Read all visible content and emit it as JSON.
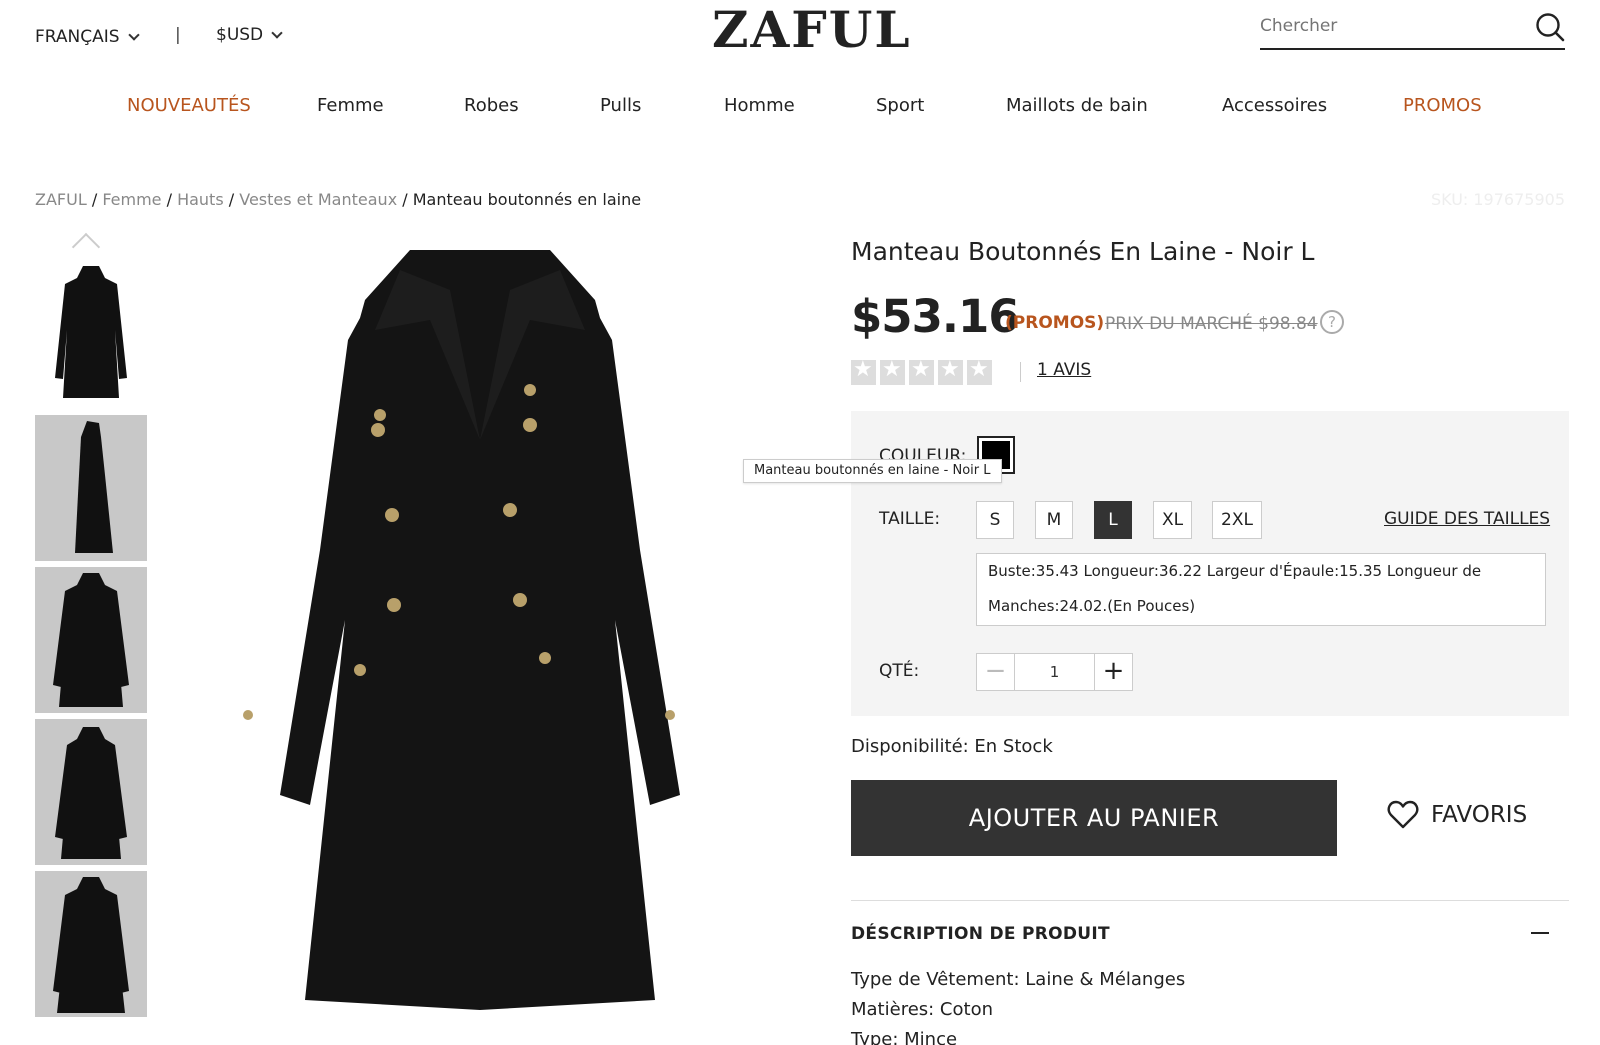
{
  "header": {
    "language": "FRANÇAIS",
    "separator": "|",
    "currency": "$USD",
    "logo": "ZAFUL",
    "search_placeholder": "Chercher"
  },
  "nav": {
    "items": [
      "NOUVEAUTÉS",
      "Femme",
      "Robes",
      "Pulls",
      "Homme",
      "Sport",
      "Maillots de bain",
      "Accessoires",
      "PROMOS"
    ]
  },
  "breadcrumb": {
    "items": [
      "ZAFUL",
      "Femme",
      "Hauts",
      "Vestes et Manteaux"
    ],
    "separator": "/",
    "current": "Manteau boutonnés en laine",
    "sku": "SKU: 197675905"
  },
  "product": {
    "title": "Manteau Boutonnés En Laine - Noir L",
    "price": "$53.16",
    "promo_label": "(PROMOS)",
    "market_price": "PRIX DU MARCHÉ $98.84",
    "help": "?",
    "rating_stars": 0,
    "reviews": "1 AVIS"
  },
  "options": {
    "color_label": "COULEUR:",
    "color_tooltip": "Manteau boutonnés en laine - Noir L",
    "size_label": "TAILLE:",
    "sizes": [
      "S",
      "M",
      "L",
      "XL",
      "2XL"
    ],
    "selected_size": "L",
    "size_guide": "GUIDE DES TAILLES",
    "measures_line1": "Buste:35.43   Longueur:36.22   Largeur d'Épaule:15.35   Longueur de",
    "measures_line2": "Manches:24.02.(En Pouces)",
    "qty_label": "QTÉ:",
    "qty_value": "1",
    "qty_minus": "−",
    "qty_plus": "+"
  },
  "availability": "Disponibilité: En Stock",
  "actions": {
    "add_to_cart": "AJOUTER AU PANIER",
    "favorites": "FAVORIS"
  },
  "description": {
    "title": "DÉSCRIPTION DE PRODUIT",
    "lines": [
      "Type de Vêtement: Laine & Mélanges",
      "Matières: Coton",
      "Type: Mince"
    ]
  },
  "colors": {
    "accent": "#b8551e",
    "dark_button": "#333333",
    "option_bg": "#f4f4f4"
  },
  "icons": {
    "search": "search-icon",
    "favorite": "heart-icon",
    "language_dropdown": "chevron-down-icon"
  }
}
